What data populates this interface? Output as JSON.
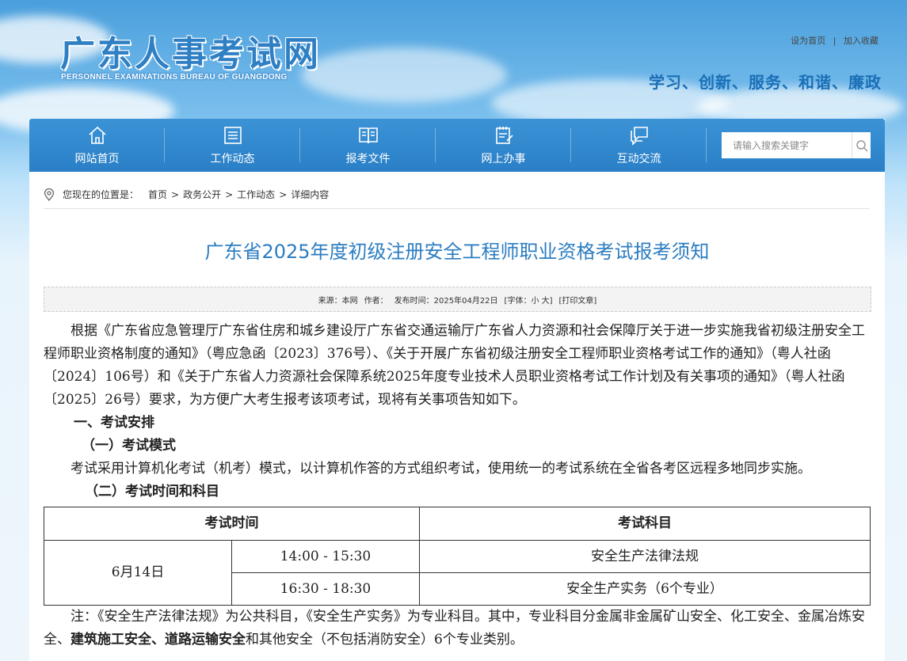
{
  "header": {
    "logo_cn": "广东人事考试网",
    "logo_en": "PERSONNEL EXAMINATIONS BUREAU OF GUANGDONG",
    "links": [
      "设为首页",
      "加入收藏"
    ],
    "link_sep": "|",
    "slogan": "学习、创新、服务、和谐、廉政"
  },
  "nav": {
    "items": [
      {
        "label": "网站首页",
        "icon": "home-icon"
      },
      {
        "label": "工作动态",
        "icon": "list-icon"
      },
      {
        "label": "报考文件",
        "icon": "book-icon"
      },
      {
        "label": "网上办事",
        "icon": "clipboard-icon"
      },
      {
        "label": "互动交流",
        "icon": "chat-icon"
      }
    ],
    "search_placeholder": "请输入搜索关键字"
  },
  "breadcrumb": {
    "label": "您现在的位置是：",
    "items": [
      "首页",
      "政务公开",
      "工作动态",
      "详细内容"
    ],
    "sep": ">"
  },
  "article": {
    "title": "广东省2025年度初级注册安全工程师职业资格考试报考须知",
    "meta": {
      "source": "来源：本网",
      "author": "作者：",
      "date": "发布时间：2025年04月22日",
      "font": "[字体：小 大]",
      "print": "[打印文章]"
    },
    "intro": "根据《广东省应急管理厅广东省住房和城乡建设厅广东省交通运输厅广东省人力资源和社会保障厅关于进一步实施我省初级注册安全工程师职业资格制度的通知》（粤应急函〔2023〕376号）、《关于开展广东省初级注册安全工程师职业资格考试工作的通知》（粤人社函〔2024〕106号）和《关于广东省人力资源社会保障系统2025年度专业技术人员职业资格考试工作计划及有关事项的通知》（粤人社函〔2025〕26号）要求，为方便广大考生报考该项考试，现将有关事项告知如下。",
    "section1": "一、考试安排",
    "section1_1": "（一）考试模式",
    "mode_text": "考试采用计算机化考试（机考）模式，以计算机作答的方式组织考试，使用统一的考试系统在全省各考区远程多地同步实施。",
    "section1_2": "（二）考试时间和科目",
    "table": {
      "headers": [
        "考试时间",
        "考试科目"
      ],
      "date": "6月14日",
      "rows": [
        {
          "time": "14:00 - 15:30",
          "subject": "安全生产法律法规"
        },
        {
          "time": "16:30 - 18:30",
          "subject": "安全生产实务（6个专业）"
        }
      ]
    },
    "note_part1": "注：《安全生产法律法规》为公共科目，《安全生产实务》为专业科目。其中，专业科目分金属非金属矿山安全、化工安全、金属冶炼安全、",
    "note_bold": "建筑施工安全、道路运输安全",
    "note_part2": "和其他安全（不包括消防安全）6个专业类别。"
  },
  "colors": {
    "nav_bg": "#2a7fc6",
    "title": "#2b7dc1",
    "slogan": "#1a6fb6"
  }
}
